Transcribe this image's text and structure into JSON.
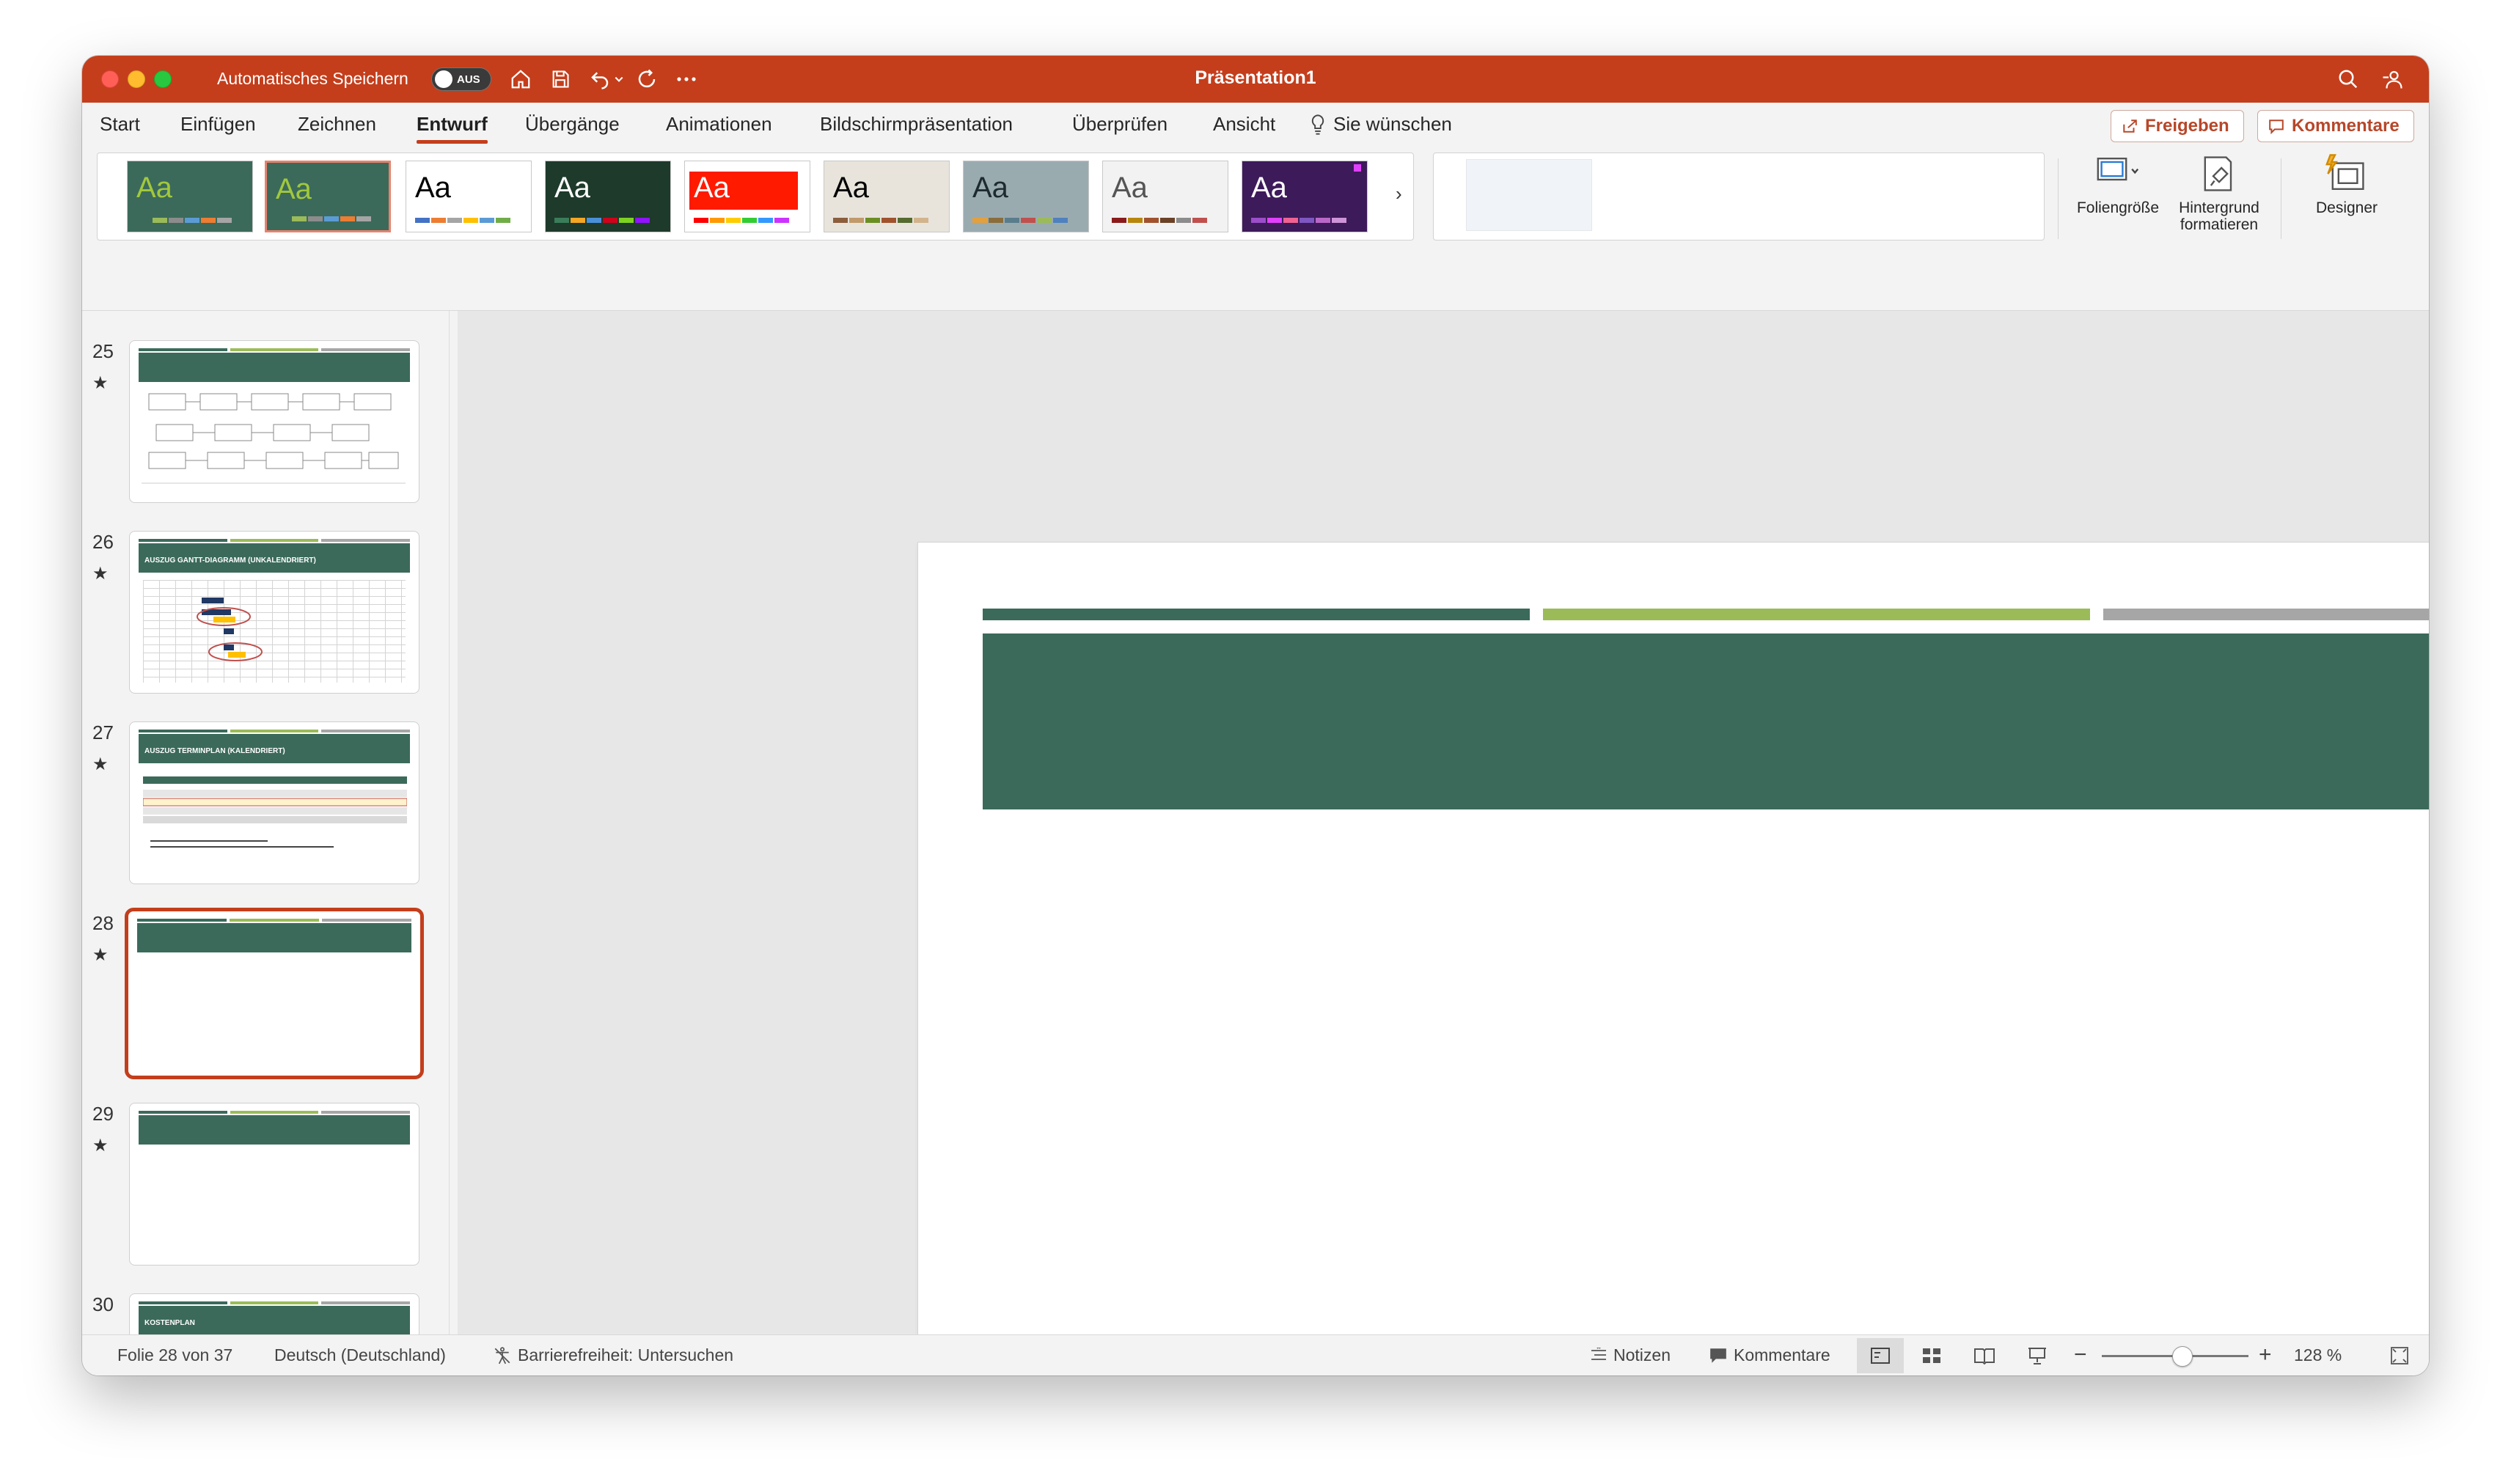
{
  "window": {
    "title": "Präsentation1",
    "autosave_label": "Automatisches Speichern",
    "autosave_state": "AUS"
  },
  "tabs": [
    {
      "label": "Start"
    },
    {
      "label": "Einfügen"
    },
    {
      "label": "Zeichnen"
    },
    {
      "label": "Entwurf",
      "active": true
    },
    {
      "label": "Übergänge"
    },
    {
      "label": "Animationen"
    },
    {
      "label": "Bildschirmpräsentation"
    },
    {
      "label": "Überprüfen"
    },
    {
      "label": "Ansicht"
    }
  ],
  "tell_me": "Sie wünschen",
  "share_button": "Freigeben",
  "comments_button": "Kommentare",
  "themes": [
    {
      "label": "Aa",
      "bg": "#3b6a5b",
      "fg": "#a2c83c",
      "swatches": [
        "#3b6a5b",
        "#9bbb59",
        "#8c8c8c",
        "#5b9bd5",
        "#ed7d31",
        "#a5a5a5"
      ]
    },
    {
      "label": "Aa",
      "bg": "#3b6a5b",
      "fg": "#a2c83c",
      "swatches": [
        "#3b6a5b",
        "#9bbb59",
        "#8c8c8c",
        "#5b9bd5",
        "#ed7d31",
        "#a5a5a5"
      ],
      "selected": true
    },
    {
      "label": "Aa",
      "bg": "#ffffff",
      "fg": "#000000",
      "swatches": [
        "#4472c4",
        "#ed7d31",
        "#a5a5a5",
        "#ffc000",
        "#5b9bd5",
        "#70ad47"
      ]
    },
    {
      "label": "Aa",
      "bg": "#1e3a2a",
      "fg": "#ffffff",
      "swatches": [
        "#3a7d5a",
        "#f5a623",
        "#4a90d9",
        "#d0021b",
        "#7ed321",
        "#9013fe"
      ]
    },
    {
      "label": "Aa",
      "bg": "#ffffff",
      "fg": "#ffffff",
      "swatches": [
        "#ff0000",
        "#ff9900",
        "#ffcc00",
        "#33cc33",
        "#3399ff",
        "#cc33ff"
      ]
    },
    {
      "label": "Aa",
      "bg": "#e8e4dc",
      "fg": "#000000",
      "swatches": [
        "#8b5e3c",
        "#c19a6b",
        "#6b8e23",
        "#a0522d",
        "#556b2f",
        "#d2b48c"
      ]
    },
    {
      "label": "Aa",
      "bg": "#9aabb0",
      "fg": "#1d2b2f",
      "swatches": [
        "#e2a03f",
        "#8a6d3b",
        "#5a7d8c",
        "#c0504d",
        "#9bbb59",
        "#4f81bd"
      ]
    },
    {
      "label": "Aa",
      "bg": "#f2f2f2",
      "fg": "#555555",
      "swatches": [
        "#8b1a1a",
        "#b8860b",
        "#a0522d",
        "#6b4226",
        "#8c8c8c",
        "#c0504d"
      ]
    },
    {
      "label": "Aa",
      "bg": "#3d1a5a",
      "fg": "#ffffff",
      "swatches": [
        "#9b4dca",
        "#e040fb",
        "#f06292",
        "#7e57c2",
        "#ba68c8",
        "#ce93d8"
      ]
    }
  ],
  "ribbon_buttons": {
    "slide_size": "Foliengröße",
    "format_background_1": "Hintergrund",
    "format_background_2": "formatieren",
    "designer": "Designer"
  },
  "slides": [
    {
      "number": "25",
      "title": "",
      "star": "★"
    },
    {
      "number": "26",
      "title": "AUSZUG GANTT-DIAGRAMM (UNKALENDRIERT)",
      "star": "★"
    },
    {
      "number": "27",
      "title": "AUSZUG TERMINPLAN (KALENDRIERT)",
      "star": "★"
    },
    {
      "number": "28",
      "title": "",
      "star": "★",
      "current": true
    },
    {
      "number": "29",
      "title": "",
      "star": "★"
    },
    {
      "number": "30",
      "title": "KOSTENPLAN",
      "star": ""
    }
  ],
  "status": {
    "slide_info": "Folie 28 von 37",
    "language": "Deutsch (Deutschland)",
    "accessibility": "Barrierefreiheit: Untersuchen",
    "notes": "Notizen",
    "comments": "Kommentare",
    "zoom": "128 %"
  },
  "colors": {
    "brand": "#c43e1c",
    "slide_band": "#3b6a5b",
    "accent_green": "#9bbb59",
    "accent_gray": "#a6a6a6"
  }
}
